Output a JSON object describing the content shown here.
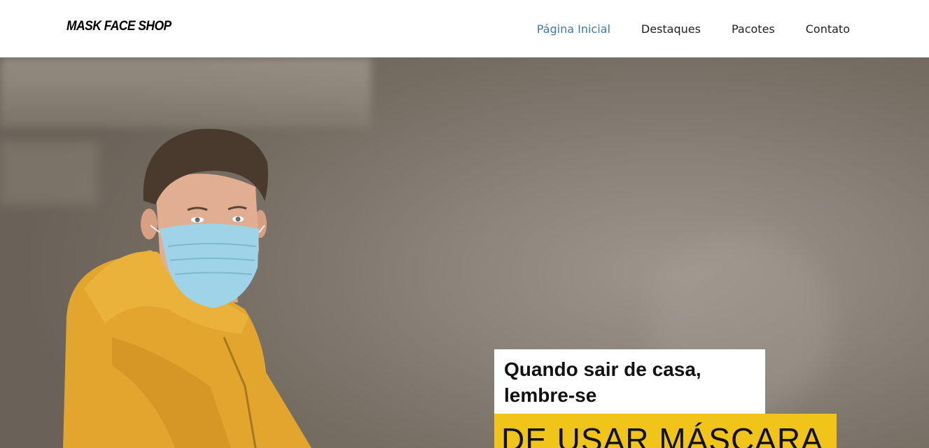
{
  "brand": {
    "name": "MASK FACE SHOP"
  },
  "nav": {
    "items": [
      {
        "label": "Página Inicial",
        "active": true
      },
      {
        "label": "Destaques",
        "active": false
      },
      {
        "label": "Pacotes",
        "active": false
      },
      {
        "label": "Contato",
        "active": false
      }
    ]
  },
  "hero": {
    "reminder": "Quando sair de casa, lembre-se",
    "headline": "DE USAR MÁSCARA"
  },
  "colors": {
    "accent_link": "#3a78b8",
    "highlight": "#f0c419",
    "jacket": "#e2a52e",
    "mask": "#9fd3e8"
  }
}
